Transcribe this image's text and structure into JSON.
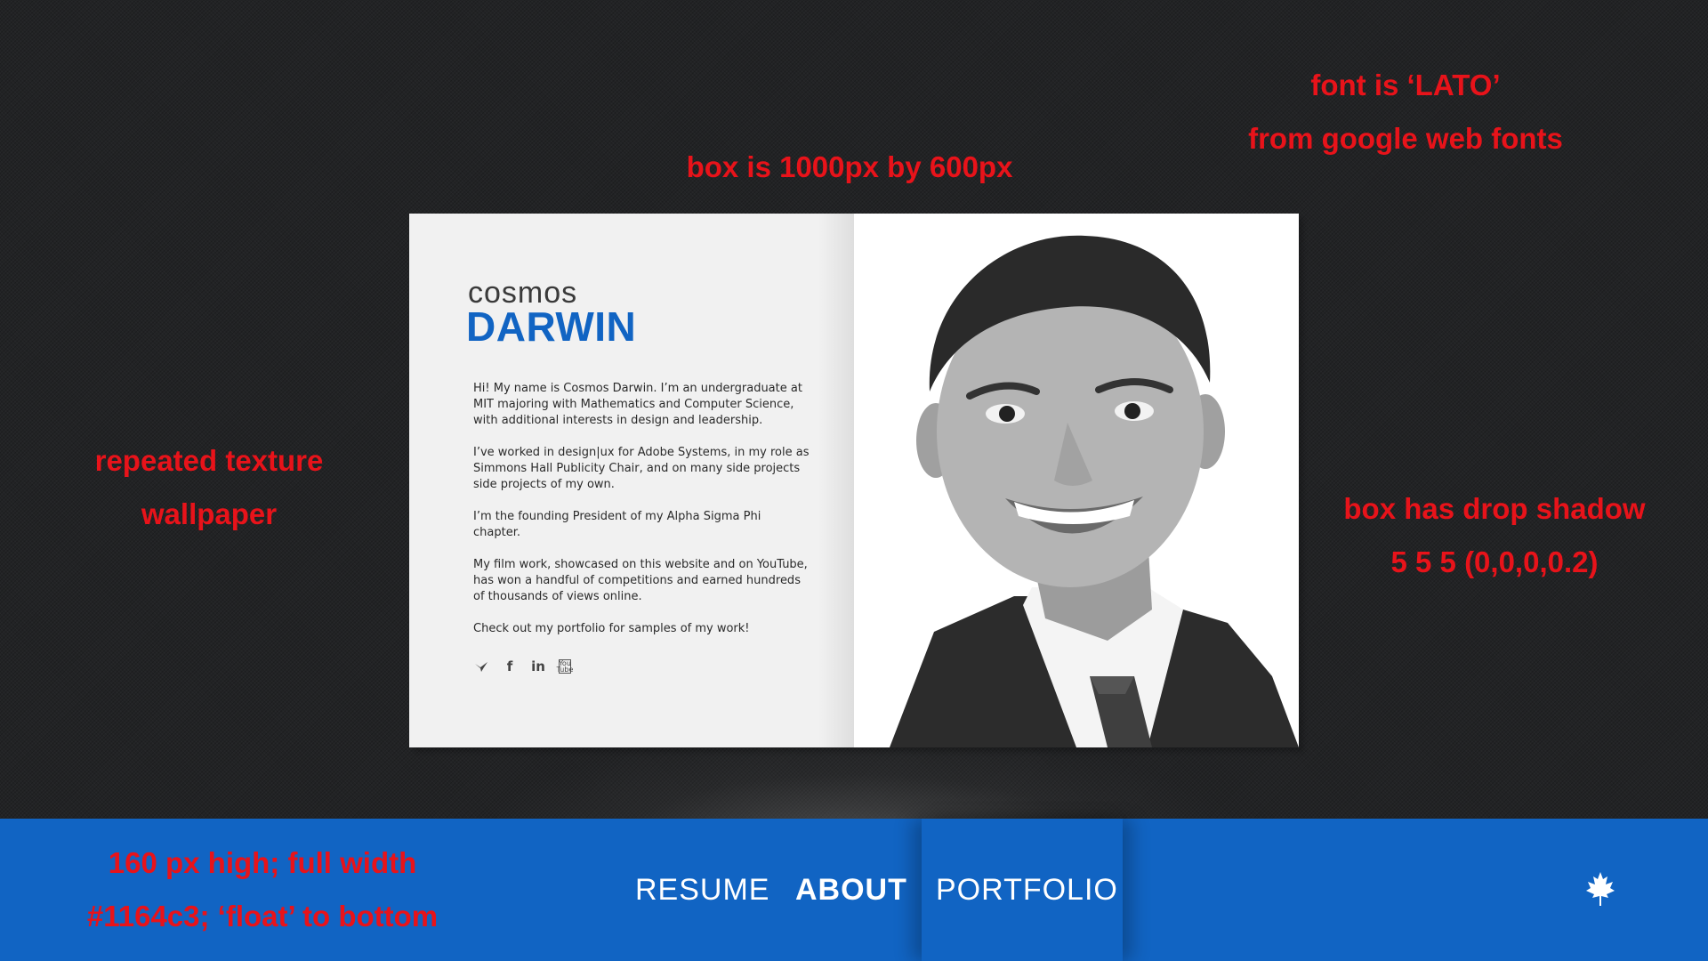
{
  "annotations": {
    "font_line1": "font is ‘LATO’",
    "font_line2": "from google web fonts",
    "box_size": "box is 1000px by 600px",
    "texture_line1": "repeated texture",
    "texture_line2": "wallpaper",
    "shadow_line1": "box has drop shadow",
    "shadow_line2": "5 5 5 (0,0,0,0.2)",
    "nav_line1": "160 px high; full width",
    "nav_line2": "#1164c3; ‘float’ to bottom"
  },
  "card": {
    "first_name": "cosmos",
    "last_name": "DARWIN",
    "bio": [
      "Hi! My name is Cosmos Darwin. I’m an undergraduate at MIT majoring with Mathematics and Computer Science, with additional interests in design and leadership.",
      "I’ve worked in design|ux for Adobe Systems, in my role as Simmons Hall Publicity Chair, and on many side projects side projects of my own.",
      "I’m the founding President of my Alpha Sigma Phi chapter.",
      "My film work, showcased on this website and on YouTube, has won a handful of competitions and earned hundreds of thousands of views online.",
      "Check out my portfolio for samples of my  work!"
    ],
    "social": {
      "facebook": "f",
      "linkedin": "in",
      "youtube_top": "You",
      "youtube_bottom": "Tube"
    }
  },
  "nav": {
    "items": [
      "RESUME",
      "ABOUT",
      "PORTFOLIO"
    ],
    "active": "ABOUT"
  },
  "colors": {
    "accent": "#1164c3",
    "annotation": "#e8131a",
    "background": "#222325"
  },
  "icons": [
    "bird-icon",
    "facebook-icon",
    "linkedin-icon",
    "youtube-icon",
    "maple-leaf-icon"
  ]
}
